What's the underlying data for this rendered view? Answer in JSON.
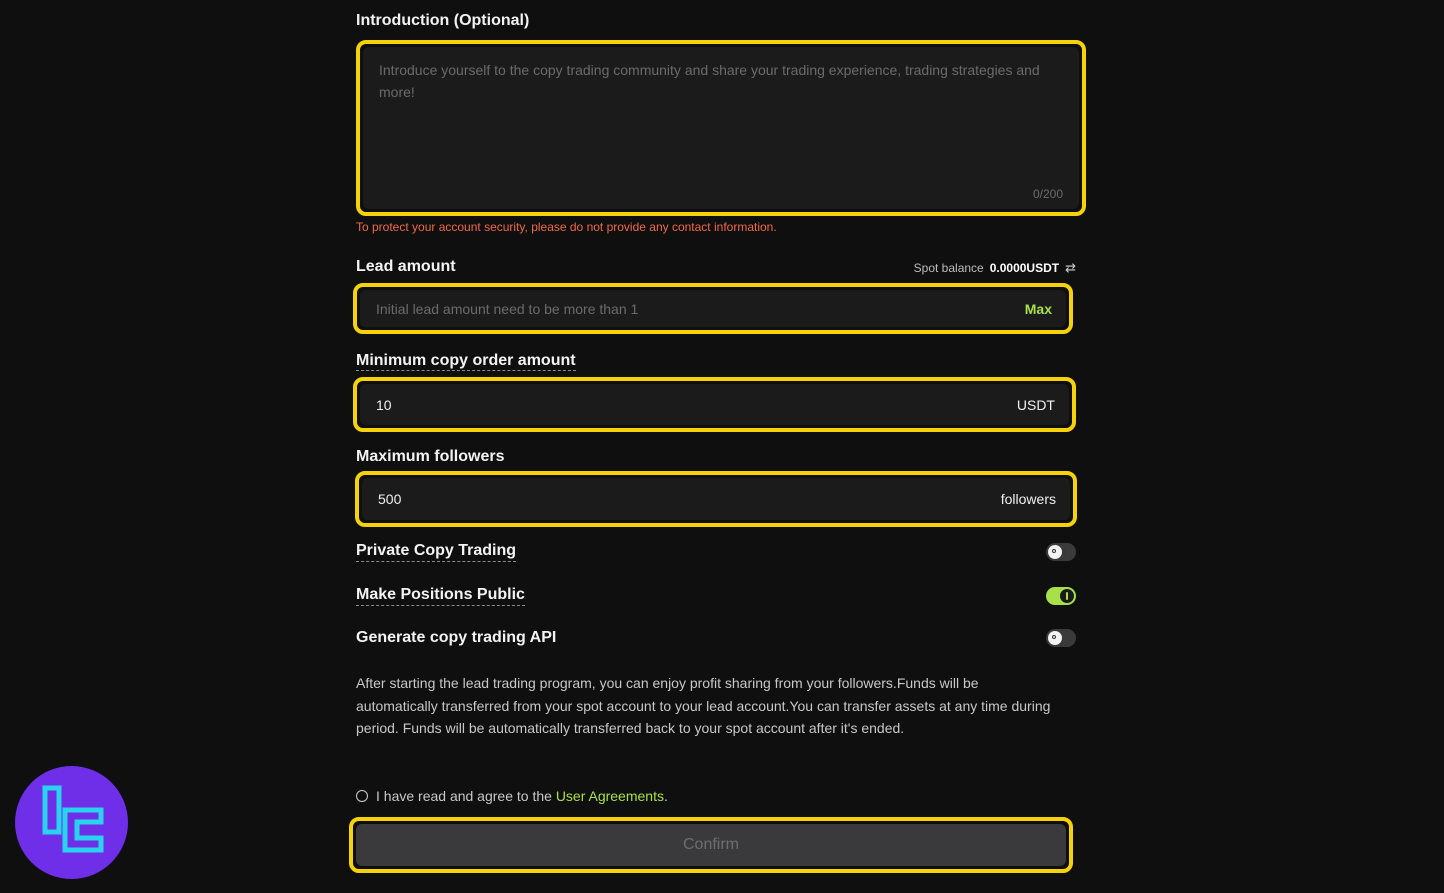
{
  "introduction": {
    "label": "Introduction (Optional)",
    "placeholder": "Introduce yourself to the copy trading community and share your trading experience, trading strategies and more!",
    "value": "",
    "counter": "0/200",
    "warning": "To protect your account security, please do not provide any contact information."
  },
  "lead_amount": {
    "label": "Lead amount",
    "balance_label": "Spot balance",
    "balance_value": "0.0000USDT",
    "placeholder": "Initial lead amount need to be more than 1",
    "max_label": "Max"
  },
  "min_copy": {
    "label": "Minimum copy order amount",
    "value": "10",
    "unit": "USDT"
  },
  "max_followers": {
    "label": "Maximum followers",
    "value": "500",
    "unit": "followers"
  },
  "toggles": [
    {
      "label": "Private Copy Trading",
      "on": false
    },
    {
      "label": "Make Positions Public",
      "on": true
    },
    {
      "label": "Generate copy trading API",
      "on": false
    }
  ],
  "info_text": "After starting the lead trading program, you can enjoy profit sharing from your followers.Funds will be automatically transferred from your spot account to your lead account.You can transfer assets at any time during period. Funds will be automatically transferred back to your spot account after it's ended.",
  "agreement": {
    "prefix": "I have read and agree to the",
    "link": "User Agreements",
    "suffix": "."
  },
  "confirm_label": "Confirm",
  "colors": {
    "highlight": "#f5d20a",
    "accent": "#a8e04a",
    "warning": "#f06a4a",
    "logo_bg": "#6f2ee8",
    "logo_fg": "#29d3ee"
  }
}
